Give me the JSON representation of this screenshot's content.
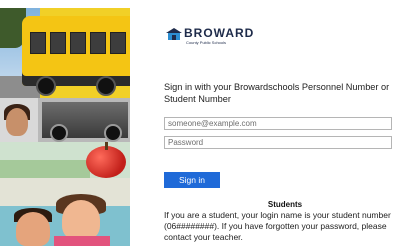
{
  "logo": {
    "name": "BROWARD",
    "subtitle": "County Public Schools"
  },
  "signin": {
    "instructions": "Sign in with your Browardschools Personnel Number or Student Number",
    "email_placeholder": "someone@example.com",
    "password_placeholder": "Password",
    "button_label": "Sign in"
  },
  "students": {
    "heading": "Students",
    "text": "If you are a student, your login name is your student number (06########). If you have forgotten your password, please contact your teacher."
  },
  "colors": {
    "accent": "#1f6ad8",
    "brand": "#1e2b4a"
  },
  "collage": [
    "school-bus-photo",
    "vintage-truck-photo",
    "apple-photo",
    "children-photo"
  ]
}
